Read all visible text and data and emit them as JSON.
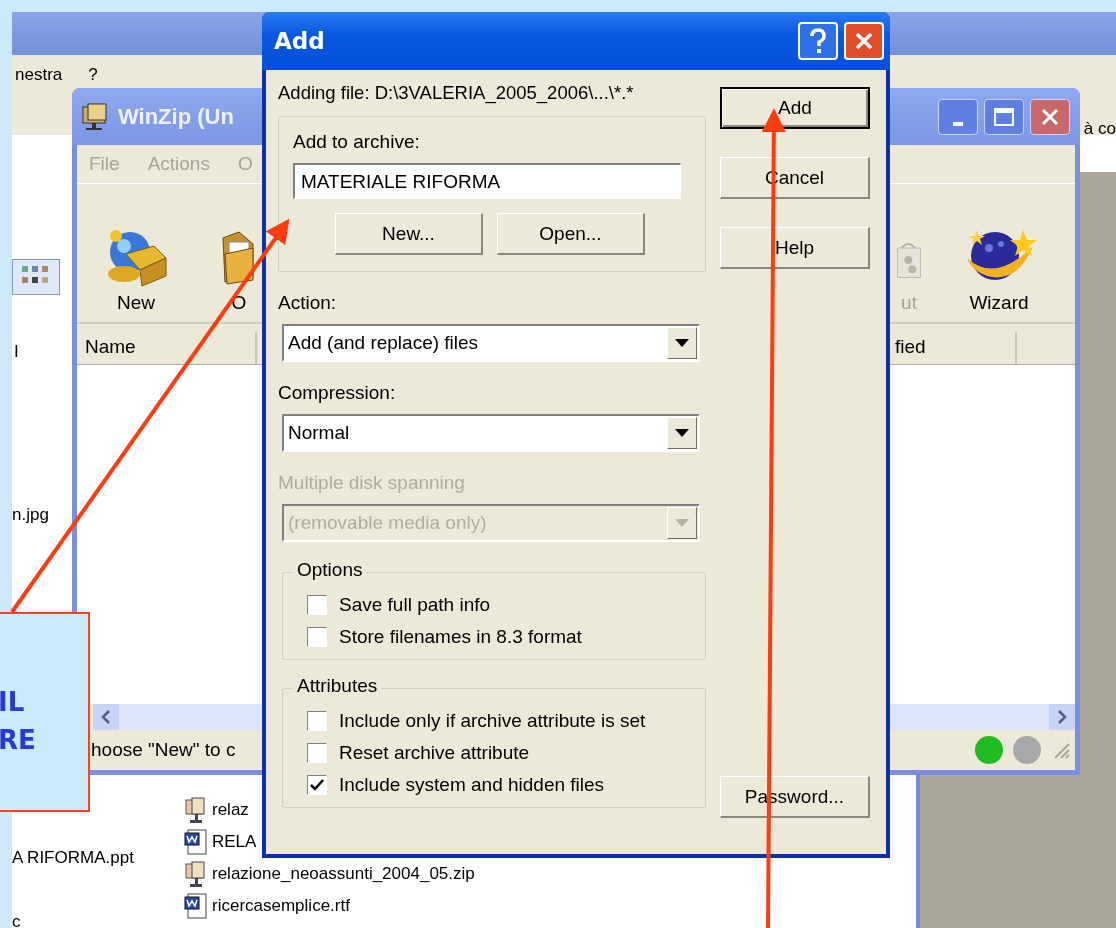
{
  "back_window": {
    "menu": [
      "nestra",
      "?"
    ],
    "toolbar_text": "à co",
    "column_1": "I",
    "files": [
      {
        "name": "n.jpg"
      },
      {
        "name": "A RIFORMA.ppt"
      },
      {
        "name": "c"
      }
    ],
    "files_2": [
      {
        "name": "relaz",
        "kind": "zip"
      },
      {
        "name": "RELA",
        "kind": "doc"
      },
      {
        "name": "relazione_neoassunti_2004_05.zip",
        "kind": "zip"
      },
      {
        "name": "ricercasemplice.rtf",
        "kind": "doc"
      }
    ]
  },
  "winzip_window": {
    "title": "WinZip (Un",
    "menu": [
      "File",
      "Actions",
      "O"
    ],
    "toolbar": [
      {
        "label": "New",
        "kind": "new",
        "disabled": false
      },
      {
        "label": "O",
        "kind": "open",
        "disabled": false
      },
      {
        "label": "ut",
        "kind": "checkout",
        "disabled": true
      },
      {
        "label": "Wizard",
        "kind": "wizard",
        "disabled": false
      }
    ],
    "columns": [
      "Name",
      "fied"
    ],
    "status_bar": "hoose \"New\" to c",
    "lights": [
      {
        "color": "#22bb22"
      },
      {
        "color": "#a8a8a8"
      }
    ]
  },
  "dialog": {
    "title": "Add",
    "adding_file": "Adding file: D:\\3VALERIA_2005_2006\\...\\*.*",
    "archive": {
      "label": "Add to archive:",
      "value": "MATERIALE RIFORMA",
      "buttons": [
        "New...",
        "Open..."
      ]
    },
    "fields": [
      {
        "label": "Action:",
        "value": "Add (and replace) files",
        "disabled": false
      },
      {
        "label": "Compression:",
        "value": "Normal",
        "disabled": false
      },
      {
        "label": "Multiple disk spanning",
        "value": "(removable media only)",
        "disabled": true
      }
    ],
    "groups": [
      {
        "title": "Options",
        "options": [
          {
            "label": "Save full path info",
            "checked": false
          },
          {
            "label": "Store filenames in 8.3 format",
            "checked": false
          }
        ]
      },
      {
        "title": "Attributes",
        "options": [
          {
            "label": "Include only if archive attribute is set",
            "checked": false
          },
          {
            "label": "Reset archive attribute",
            "checked": false
          },
          {
            "label": "Include system and hidden files",
            "checked": true
          }
        ]
      }
    ],
    "buttons": [
      {
        "label": "Add",
        "default": true
      },
      {
        "label": "Cancel",
        "default": false
      },
      {
        "label": "Help",
        "default": false
      }
    ],
    "password_button": "Password..."
  },
  "callout": {
    "lines": [
      "IL",
      "RE"
    ]
  }
}
